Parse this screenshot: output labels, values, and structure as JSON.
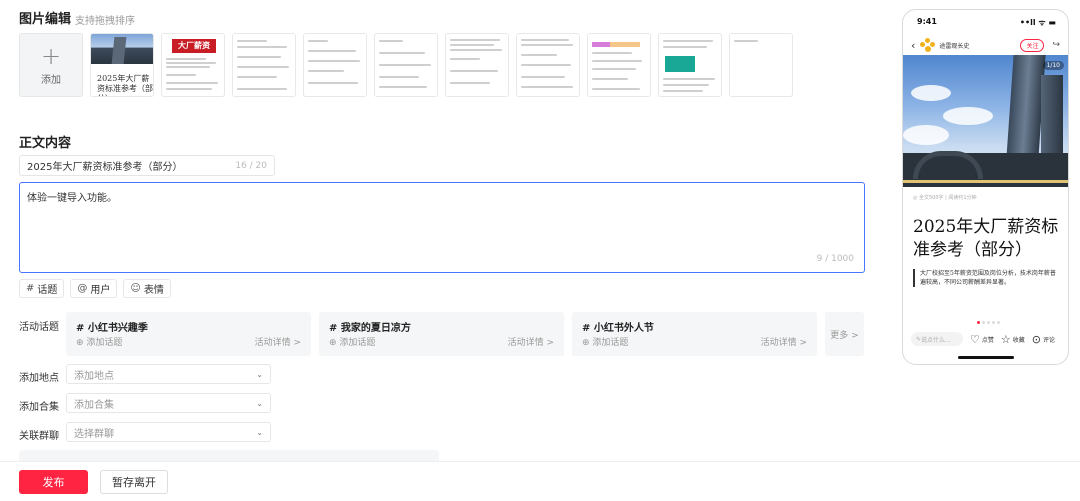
{
  "images": {
    "title": "图片编辑",
    "hint": "支持拖拽排序",
    "add_label": "添加",
    "thumb1_text": "2025年大厂薪资标准参考（部分）",
    "thumb2_banner": "大厂薪资"
  },
  "content": {
    "title": "正文内容",
    "title_value": "2025年大厂薪资标准参考（部分）",
    "title_count": "16 / 20",
    "body_value": "体验一键导入功能。",
    "body_count": "9 / 1000"
  },
  "tools": [
    {
      "icon": "#",
      "label": "话题"
    },
    {
      "icon": "@",
      "label": "用户"
    },
    {
      "icon": "☺",
      "label": "表情"
    }
  ],
  "topics": {
    "label": "活动话题",
    "add_label": "添加话题",
    "detail_label": "活动详情 >",
    "more_label": "更多 >",
    "items": [
      "# 小红书兴趣季",
      "# 我家的夏日凉方",
      "# 小红书外人节"
    ]
  },
  "fields": {
    "location": {
      "label": "添加地点",
      "placeholder": "添加地点"
    },
    "collection": {
      "label": "添加合集",
      "placeholder": "添加合集"
    },
    "group": {
      "label": "关联群聊",
      "placeholder": "选择群聊"
    }
  },
  "actions": {
    "publish": "发布",
    "draft": "暂存离开"
  },
  "preview": {
    "time": "9:41",
    "signal": "••ll ᯤ ▬",
    "author": "途雷观长史",
    "follow": "关注",
    "page_indicator": "1/10",
    "meta": "◎ 全文500字 | 阅读约1分钟",
    "title": "2025年大厂薪资标准参考（部分）",
    "quote": "大厂校招至5年薪资范围及岗位分析，技术岗年薪普遍较高，不同公司薪酬差异显著。",
    "comment_placeholder": "说点什么...",
    "like": "点赞",
    "collect": "收藏",
    "comment": "评论"
  },
  "colors": {
    "accent": "#ff2442",
    "focus": "#4a74ff"
  }
}
